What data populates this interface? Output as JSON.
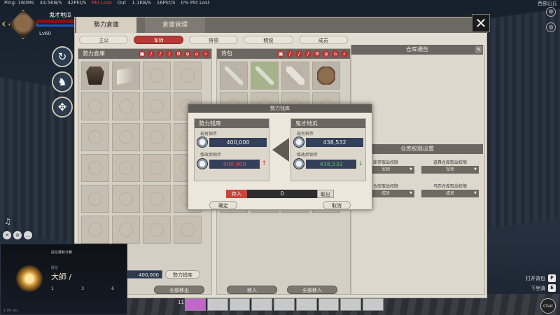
{
  "netbar": [
    "Ping: 160Ms",
    "34.5KB/S",
    "42Pkt/S",
    "Pkt Loss",
    "Out",
    "1.1KB/S",
    "16Pkt/S",
    "0% Pkt Lost"
  ],
  "player": {
    "name": "鬼才地瓜",
    "level": "Lv60"
  },
  "hud": {
    "region": "西部山丘",
    "open_bag": "打开背包",
    "open_bag_key": "F",
    "next_key_label": "下坐骑",
    "next_key": "E",
    "chat": "Chat"
  },
  "tabs": [
    {
      "label": "勢力倉庫",
      "active": true
    },
    {
      "label": "倉庫管理",
      "active": false
    }
  ],
  "subtabs": [
    {
      "label": "主公"
    },
    {
      "label": "军师",
      "active": true
    },
    {
      "label": "将领"
    },
    {
      "label": "精锐"
    },
    {
      "label": "成员"
    }
  ],
  "guild_storage": {
    "title": "勢力倉庫",
    "money": "400,000",
    "money_button": "勢力钱库",
    "move_all_button": "全部移出"
  },
  "backpack": {
    "title": "背包",
    "move_button": "移入",
    "move_all_button": "全部移入"
  },
  "filter_icons": [
    "all-icon",
    "weapon-icon",
    "armor-icon",
    "material-icon",
    "consumable-icon",
    "quest-icon",
    "misc-icon",
    "search-icon"
  ],
  "notice": {
    "title": "仓库通告"
  },
  "permissions": {
    "title": "仓库权限设置",
    "items": [
      {
        "label": "库存取出权限",
        "value": "军师"
      },
      {
        "label": "道具仓库取出权限",
        "value": "军师"
      },
      {
        "label": "仓库取出权限",
        "value": "成员"
      },
      {
        "label": "马匹仓库取出权限",
        "value": "成员"
      }
    ]
  },
  "dialog": {
    "title": "勢力钱库",
    "left": {
      "title": "勢力钱库",
      "current_label": "现有铜币",
      "current": "400,000",
      "after_label": "修改后铜币",
      "after": "400,000"
    },
    "right": {
      "title": "鬼才地瓜",
      "current_label": "现有铜币",
      "current": "438,532",
      "after_label": "修改后铜币",
      "after": "438,532"
    },
    "deposit_label": "存入",
    "amount": "0",
    "withdraw_label": "取出",
    "confirm": "确定",
    "cancel": "取消"
  },
  "overlay": {
    "title": "段位赛积分賽",
    "sub": "段位",
    "rank": "大師 /",
    "stats": [
      {
        "v": "1"
      },
      {
        "v": "3"
      },
      {
        "v": "6"
      }
    ],
    "foot": "1.00 sec"
  },
  "hotbar_count": "11"
}
